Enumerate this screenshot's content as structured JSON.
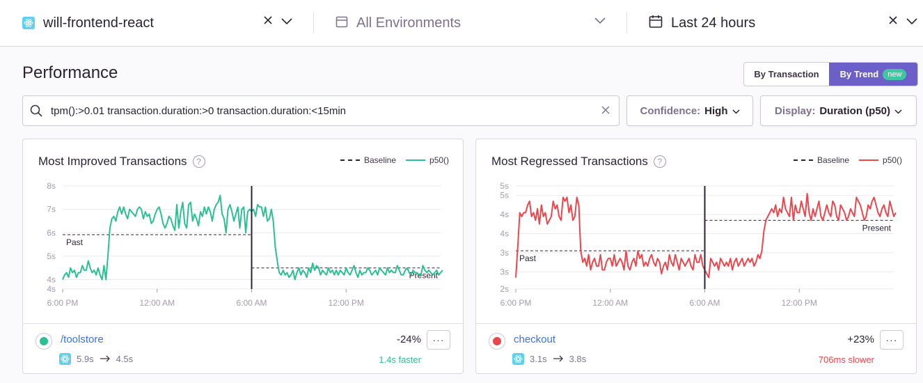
{
  "topbar": {
    "project": "will-frontend-react",
    "environment": "All Environments",
    "date_range": "Last 24 hours"
  },
  "page": {
    "title": "Performance",
    "view_toggle": {
      "by_transaction": "By Transaction",
      "by_trend": "By Trend",
      "new_badge": "new"
    }
  },
  "search": {
    "query": "tpm():>0.01 transaction.duration:>0 transaction.duration:<15min"
  },
  "filters": {
    "confidence": {
      "key": "Confidence:",
      "value": "High"
    },
    "display": {
      "key": "Display:",
      "value": "Duration (p50)"
    }
  },
  "colors": {
    "improved": "#2bbf94",
    "regressed": "#e9474d",
    "accent": "#6c5fc7",
    "link": "#3d74db"
  },
  "cards": [
    {
      "title": "Most Improved Transactions",
      "legend": {
        "baseline": "Baseline",
        "series": "p50()"
      },
      "transaction": "/toolstore",
      "from": "5.9s",
      "to": "4.5s",
      "percent": "-24%",
      "note": "1.4s faster",
      "note_color": "#2bbf94",
      "dot_color": "#2bbf94"
    },
    {
      "title": "Most Regressed Transactions",
      "legend": {
        "baseline": "Baseline",
        "series": "p50()"
      },
      "transaction": "checkout",
      "from": "3.1s",
      "to": "3.8s",
      "percent": "+23%",
      "note": "706ms slower",
      "note_color": "#e9474d",
      "dot_color": "#e9474d"
    }
  ],
  "chart_data": [
    {
      "type": "line",
      "title": "Most Improved Transactions",
      "y_tick_labels": [
        "8s",
        "7s",
        "6s",
        "5s",
        "4s",
        "4s"
      ],
      "y_ticks": [
        8,
        7,
        6,
        5,
        4,
        3.6
      ],
      "ylim": [
        3.6,
        8
      ],
      "x_tick_labels": [
        "6:00 PM",
        "12:00 AM",
        "6:00 AM",
        "12:00 PM"
      ],
      "x_ticks": [
        0,
        6,
        12,
        18
      ],
      "xlim": [
        0,
        24
      ],
      "breakpoint_x": 12,
      "baseline": [
        {
          "label": "Past",
          "x0": 0,
          "x1": 12,
          "y": 5.92
        },
        {
          "label": "Present",
          "x0": 12,
          "x1": 24,
          "y": 4.5
        }
      ],
      "series": [
        {
          "name": "p50()",
          "color": "#2bbf94",
          "x_start": 0,
          "x_step": 0.125,
          "values": [
            4.0,
            4.2,
            4.3,
            4.1,
            4.5,
            4.3,
            4.4,
            4.1,
            4.3,
            4.3,
            4.6,
            4.4,
            4.4,
            4.8,
            4.5,
            4.3,
            4.4,
            4.2,
            4.5,
            4.2,
            4.0,
            4.6,
            4.0,
            5.0,
            6.2,
            6.6,
            6.7,
            6.5,
            6.9,
            7.1,
            6.8,
            7.1,
            6.8,
            6.6,
            7.0,
            6.9,
            6.8,
            6.7,
            7.0,
            7.1,
            7.0,
            6.6,
            6.9,
            6.7,
            6.8,
            6.4,
            6.5,
            6.8,
            7.0,
            7.1,
            6.8,
            6.4,
            6.2,
            6.4,
            6.7,
            6.6,
            6.3,
            6.1,
            7.2,
            6.2,
            6.9,
            7.3,
            6.4,
            6.2,
            7.2,
            7.3,
            6.5,
            6.8,
            6.6,
            6.3,
            6.9,
            6.7,
            7.1,
            6.8,
            7.1,
            6.9,
            6.5,
            7.0,
            7.2,
            7.3,
            7.6,
            6.8,
            6.6,
            6.0,
            7.0,
            7.2,
            6.9,
            6.5,
            6.8,
            7.1,
            6.2,
            7.0,
            7.1,
            6.0,
            6.9,
            7.0,
            6.9,
            7.0,
            6.7,
            7.2,
            7.1,
            7.1,
            6.7,
            7.1,
            6.5,
            6.6,
            7.0,
            6.5,
            5.4,
            4.8,
            4.3,
            4.2,
            4.4,
            4.2,
            4.3,
            4.1,
            4.2,
            4.4,
            4.0,
            4.3,
            4.5,
            4.2,
            4.4,
            4.3,
            4.1,
            4.5,
            4.3,
            4.7,
            4.4,
            4.6,
            4.5,
            4.2,
            4.4,
            4.3,
            4.2,
            4.5,
            4.3,
            4.4,
            4.2,
            4.4,
            4.2,
            4.4,
            4.3,
            4.2,
            4.5,
            4.3,
            4.2,
            4.4,
            4.6,
            4.3,
            4.1,
            4.4,
            4.2,
            4.3,
            4.3,
            4.5,
            4.4,
            4.2,
            4.3,
            4.4,
            4.2,
            4.5,
            4.4,
            4.3,
            4.2,
            4.5,
            4.3,
            4.4,
            4.3,
            4.3,
            4.6,
            4.4,
            4.2,
            4.2,
            4.4,
            4.5,
            4.3,
            4.2,
            4.4,
            4.3,
            4.3,
            4.2,
            4.2,
            4.6,
            4.4,
            4.3,
            4.4,
            4.3,
            4.2,
            4.3,
            4.4,
            4.2,
            4.3,
            4.4
          ]
        }
      ]
    },
    {
      "type": "line",
      "title": "Most Regressed Transactions",
      "y_tick_labels": [
        "5s",
        "5s",
        "4s",
        "4s",
        "3s",
        "3s",
        "2s"
      ],
      "y_ticks": [
        5.0,
        4.75,
        4.25,
        3.75,
        3.25,
        2.75,
        2.3
      ],
      "ylim": [
        2.3,
        5.0
      ],
      "x_tick_labels": [
        "6:00 PM",
        "12:00 AM",
        "6:00 AM",
        "12:00 PM"
      ],
      "x_ticks": [
        0,
        6,
        12,
        18
      ],
      "xlim": [
        0,
        24
      ],
      "breakpoint_x": 12,
      "baseline": [
        {
          "label": "Past",
          "x0": 0,
          "x1": 12,
          "y": 3.3
        },
        {
          "label": "Present",
          "x0": 12,
          "x1": 24,
          "y": 4.1
        }
      ],
      "series": [
        {
          "name": "p50()",
          "color": "#e9474d",
          "x_start": 0,
          "x_step": 0.125,
          "values": [
            2.6,
            3.4,
            4.3,
            4.2,
            4.3,
            4.3,
            4.5,
            4.6,
            4.2,
            4.3,
            4.1,
            4.4,
            4.0,
            4.5,
            4.2,
            4.3,
            4.0,
            4.1,
            4.2,
            4.6,
            4.4,
            4.5,
            4.2,
            4.1,
            4.7,
            4.6,
            4.7,
            4.3,
            4.5,
            4.1,
            4.2,
            4.7,
            4.5,
            3.3,
            3.0,
            3.1,
            2.9,
            3.2,
            2.8,
            3.0,
            3.1,
            2.9,
            2.9,
            3.2,
            2.8,
            2.8,
            3.0,
            3.1,
            3.1,
            2.9,
            3.2,
            2.9,
            3.0,
            3.1,
            3.0,
            2.8,
            3.3,
            2.9,
            2.8,
            3.0,
            3.1,
            2.9,
            3.3,
            3.1,
            3.2,
            2.9,
            3.0,
            2.9,
            3.1,
            3.2,
            3.0,
            2.9,
            3.1,
            3.0,
            2.7,
            2.9,
            3.0,
            2.8,
            3.2,
            3.0,
            2.9,
            3.2,
            3.0,
            2.8,
            3.1,
            3.0,
            2.9,
            3.0,
            3.1,
            2.9,
            2.8,
            3.2,
            3.0,
            3.0,
            3.2,
            2.9,
            2.8,
            2.7,
            2.6,
            3.1,
            3.0,
            2.9,
            3.0,
            2.8,
            3.1,
            3.0,
            2.9,
            3.0,
            2.9,
            3.1,
            2.8,
            3.0,
            3.1,
            2.9,
            3.0,
            3.1,
            2.9,
            3.0,
            3.1,
            3.0,
            3.1,
            2.9,
            3.0,
            3.2,
            3.1,
            3.3,
            3.8,
            4.1,
            4.2,
            4.3,
            4.4,
            4.3,
            4.5,
            4.2,
            4.4,
            4.3,
            4.7,
            4.4,
            4.3,
            4.2,
            4.7,
            4.1,
            4.5,
            4.3,
            4.3,
            4.6,
            4.4,
            4.2,
            4.8,
            4.3,
            4.1,
            4.4,
            4.2,
            4.4,
            4.6,
            4.2,
            4.1,
            4.3,
            4.5,
            4.3,
            4.2,
            4.6,
            4.5,
            4.2,
            4.1,
            4.5,
            4.4,
            4.3,
            4.1,
            4.2,
            4.4,
            4.3,
            4.2,
            4.7,
            4.6,
            4.5,
            4.3,
            4.1,
            4.2,
            4.5,
            4.4,
            4.6,
            4.7,
            4.5,
            4.3,
            4.2,
            4.4,
            4.5,
            4.3,
            4.2,
            4.6,
            4.4,
            4.2,
            4.3
          ]
        }
      ]
    }
  ]
}
